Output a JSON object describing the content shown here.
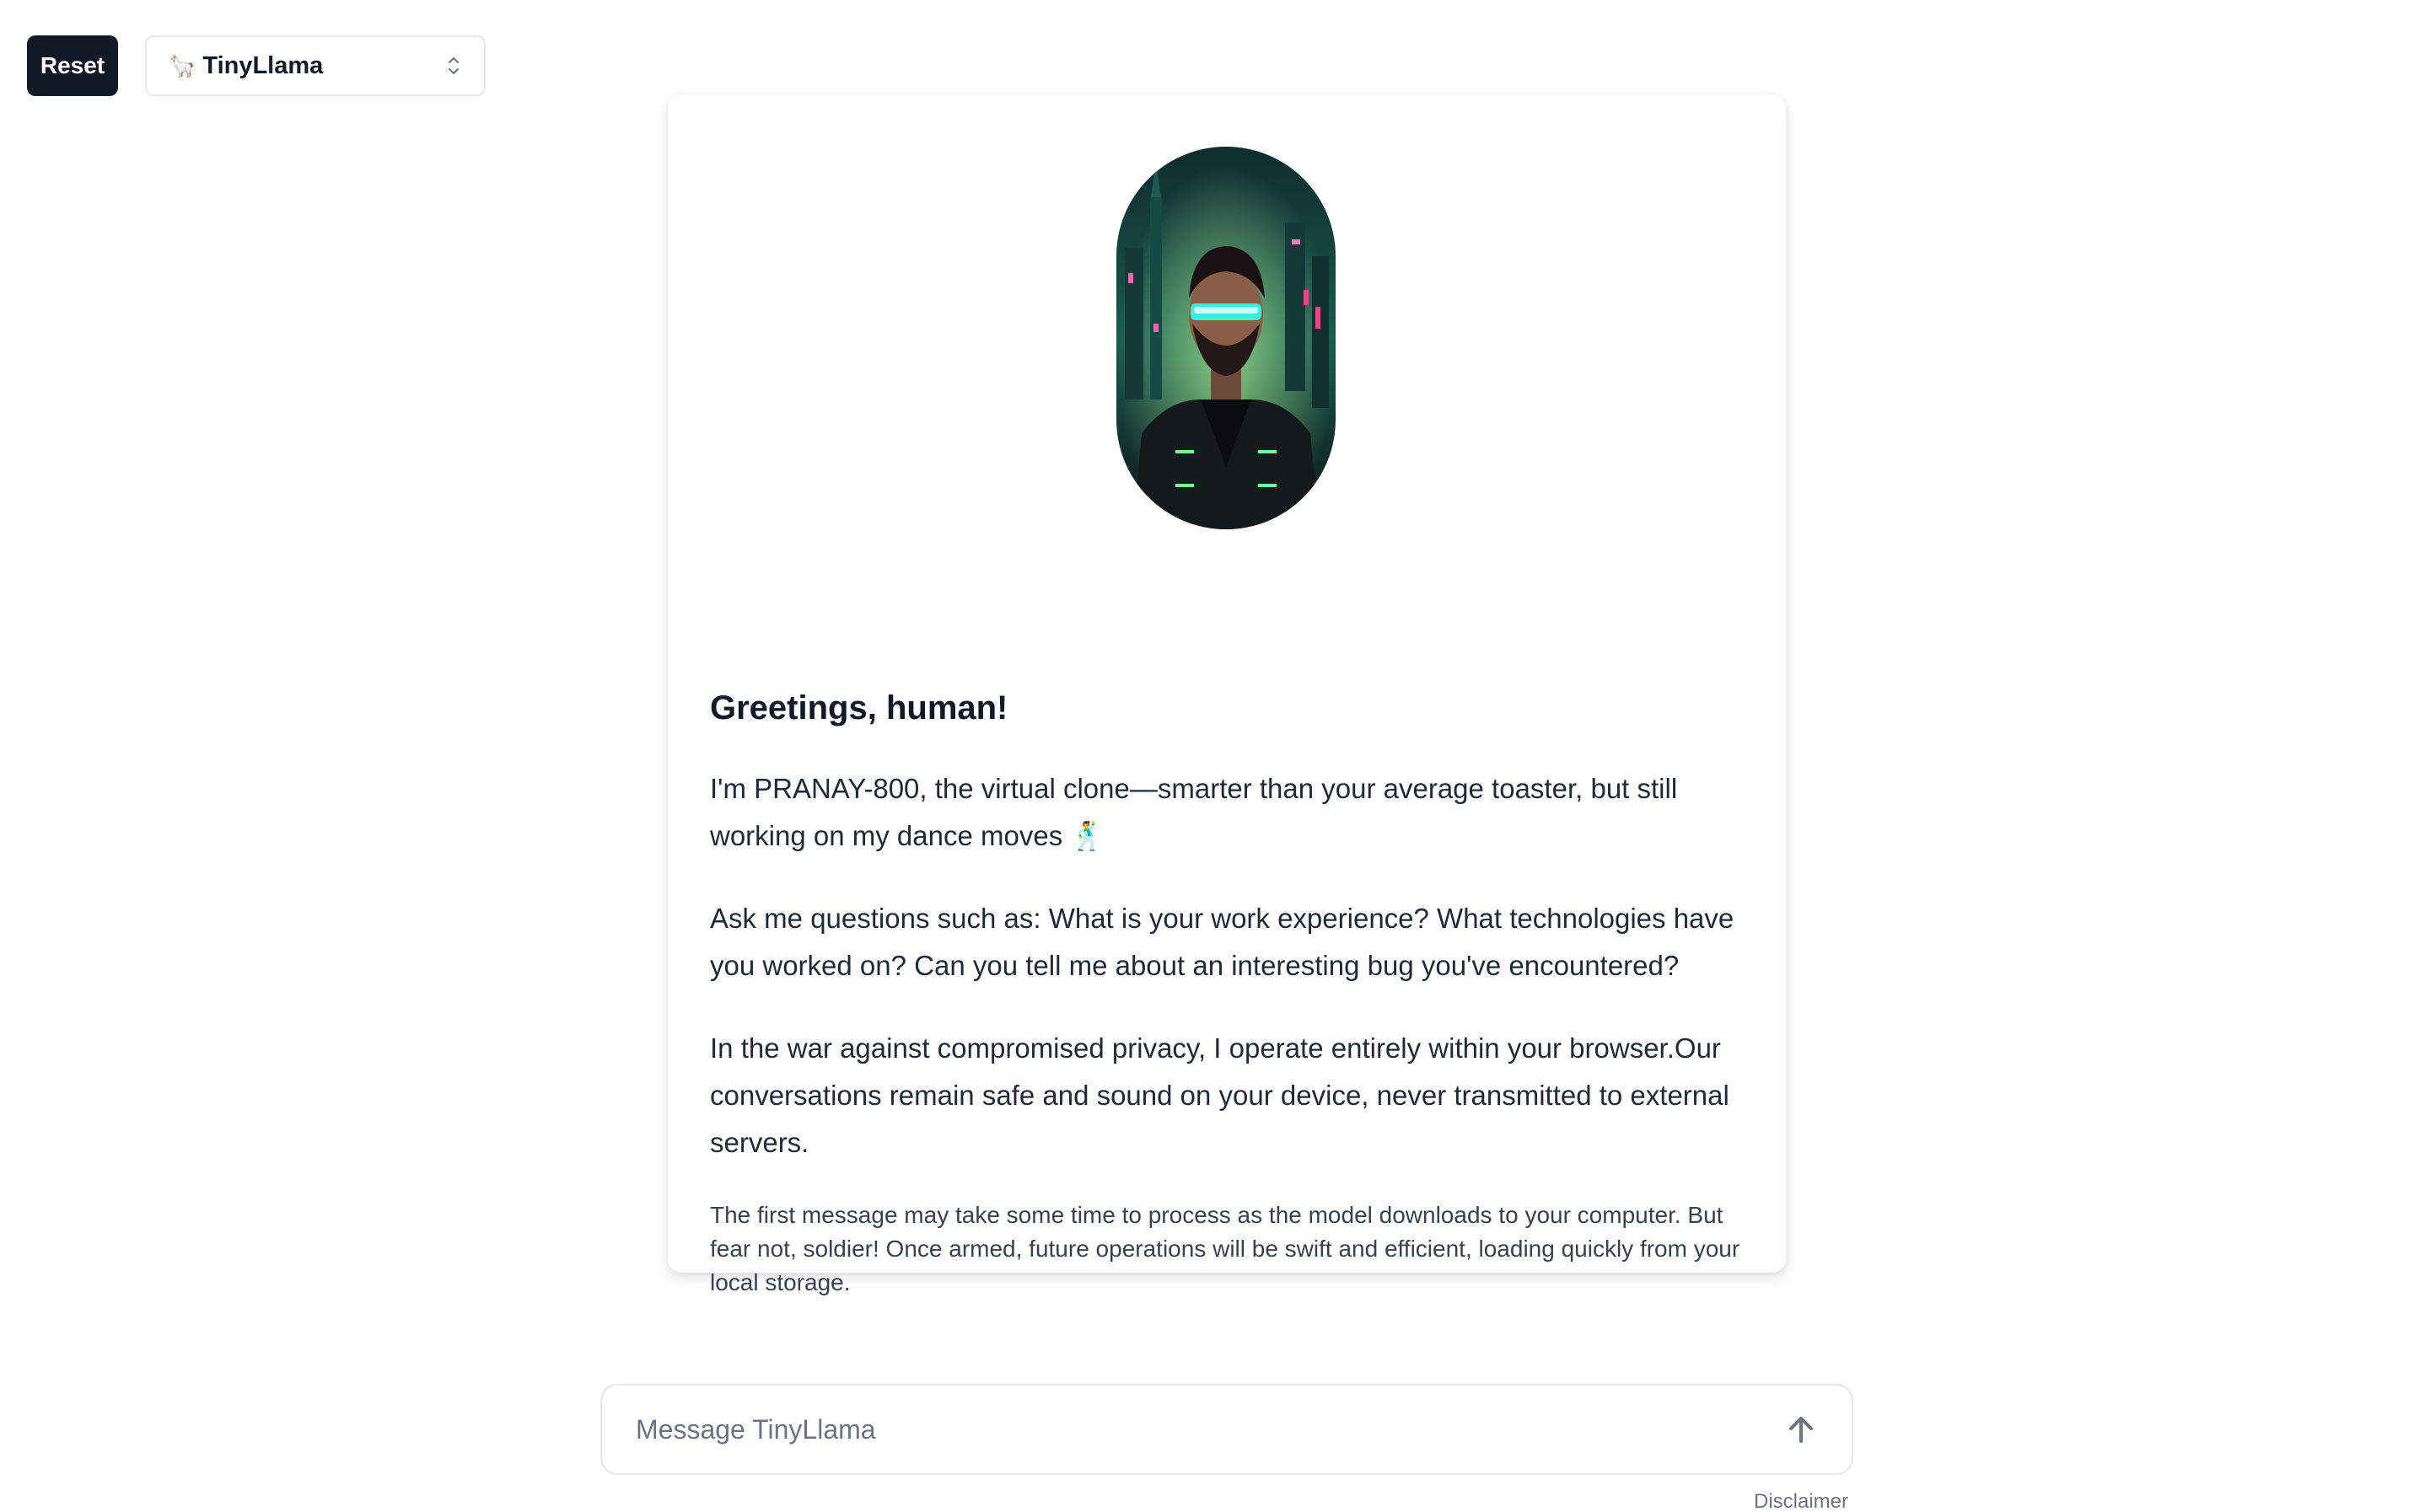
{
  "toolbar": {
    "reset_label": "Reset",
    "model_icon": "🦙",
    "model_label": "TinyLlama"
  },
  "intro": {
    "avatar_icon": "cyberpunk-avatar-portrait",
    "heading": "Greetings, human!",
    "paragraphs": [
      "I'm PRANAY-800, the virtual clone—smarter than your average toaster, but still working on my dance moves 🕺",
      "Ask me questions such as: What is your work experience? What technologies have you worked on? Can you tell me about an interesting bug you've encountered?",
      "In the war against compromised privacy, I operate entirely within your browser.Our conversations remain safe and sound on your device, never transmitted to external servers."
    ],
    "note": "The first message may take some time to process as the model downloads to your computer. But fear not, soldier! Once armed, future operations will be swift and efficient, loading quickly from your local storage."
  },
  "composer": {
    "placeholder": "Message TinyLlama",
    "value": "",
    "send_icon": "arrow-up-icon"
  },
  "footer": {
    "disclaimer": "Disclaimer"
  },
  "colors": {
    "button_dark": "#111827",
    "border": "#e5e7eb",
    "text": "#1f2937",
    "muted": "#6b7280"
  }
}
